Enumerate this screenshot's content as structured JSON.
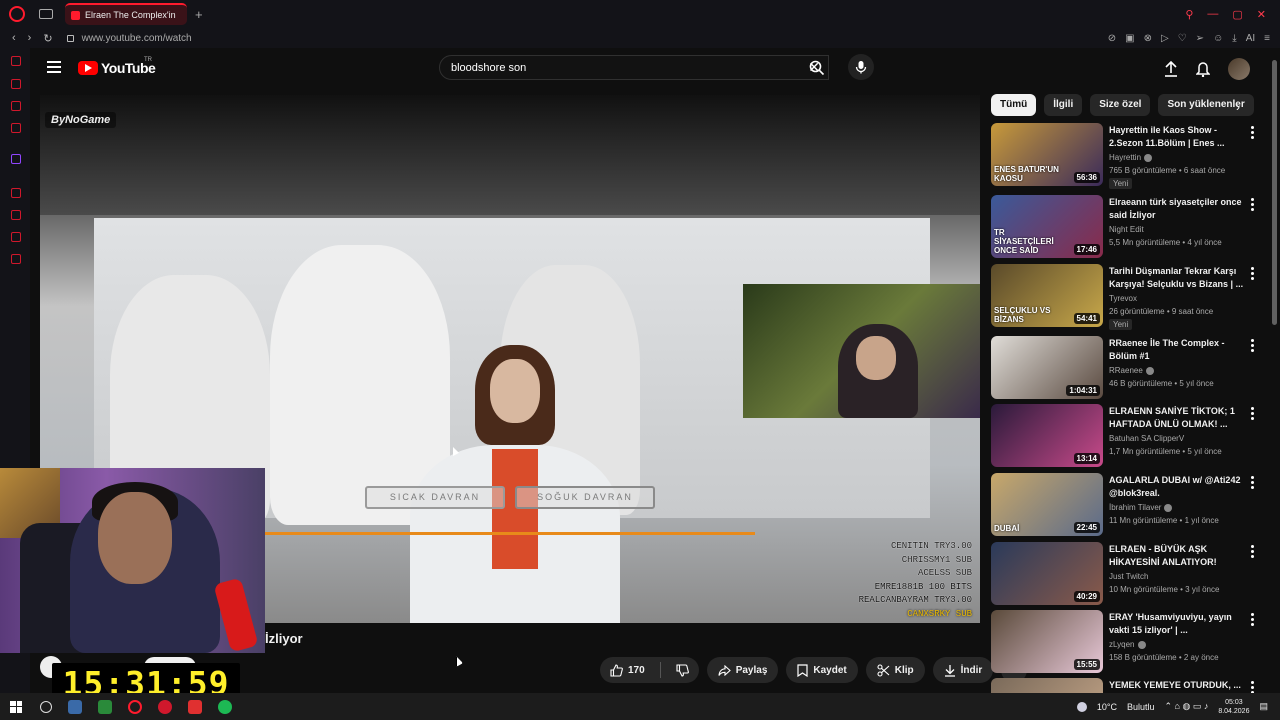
{
  "browser": {
    "tab_title": "Elraen The Complex'in",
    "url": "www.youtube.com/watch",
    "accent_color": "#ff1b2d",
    "ai_label": "AI"
  },
  "youtube": {
    "logo_text": "YouTube",
    "country_code": "TR",
    "search_value": "bloodshore son"
  },
  "video": {
    "watermark": "ByNoGame",
    "choice_hot": "SICAK DAVRAN",
    "choice_cold": "SOĞUK DAVRAN",
    "donations": [
      "CENITIN TRY3.00",
      "CHRISSMY1 SUB",
      "ACELSS SUB",
      "EMRE1881B 100 BITS",
      "REALCANBAYRAM TRY3.00",
      "CANXSRKY SUB"
    ],
    "title_visible": "İzliyor"
  },
  "actions": {
    "likes": "170",
    "share": "Paylaş",
    "save": "Kaydet",
    "clip": "Klip",
    "download": "İndir"
  },
  "overlay": {
    "clock": "15:31:59"
  },
  "chips": [
    "Tümü",
    "İlgili",
    "Size özel",
    "Son yüklenenler"
  ],
  "recommendations": [
    {
      "title": "Hayrettin ile Kaos Show - 2.Sezon 11.Bölüm | Enes ...",
      "channel": "Hayrettin",
      "verified": true,
      "meta": "765 B görüntüleme • 6 saat önce",
      "badge": "Yeni",
      "duration": "56:36",
      "thumb_text": "ENES BATUR'UN KAOSU",
      "colors": [
        "#c89a3a",
        "#3a2a5a"
      ]
    },
    {
      "title": "Elraeann türk siyasetçiler once said İzliyor",
      "channel": "Night Edit",
      "verified": false,
      "meta": "5,5 Mn görüntüleme • 4 yıl önce",
      "badge": "",
      "duration": "17:46",
      "thumb_text": "TR SİYASETÇİLERİ ONCE SAİD",
      "colors": [
        "#3a5a9a",
        "#8a2a4a"
      ]
    },
    {
      "title": "Tarihi Düşmanlar Tekrar Karşı Karşıya! Selçuklu vs Bizans | ...",
      "channel": "Tyrevox",
      "verified": false,
      "meta": "26 görüntüleme • 9 saat önce",
      "badge": "Yeni",
      "duration": "54:41",
      "thumb_text": "SELÇUKLU VS BİZANS",
      "colors": [
        "#5a4a2a",
        "#c8a84a"
      ]
    },
    {
      "title": "RRaenee İle The Complex - Bölüm #1",
      "channel": "RRaenee",
      "verified": true,
      "meta": "46 B görüntüleme • 5 yıl önce",
      "badge": "",
      "duration": "1:04:31",
      "thumb_text": "",
      "colors": [
        "#e0ddd8",
        "#5a4a40"
      ]
    },
    {
      "title": "ELRAENN SANİYE TİKTOK; 1 HAFTADA ÜNLÜ OLMAK! ...",
      "channel": "Batuhan SA ClipperV",
      "verified": false,
      "meta": "1,7 Mn görüntüleme • 5 yıl önce",
      "badge": "",
      "duration": "13:14",
      "thumb_text": "",
      "colors": [
        "#2a1a3a",
        "#c84a8a"
      ]
    },
    {
      "title": "AGALARLA DUBAI w/ @Ati242 @blok3real.",
      "channel": "İbrahim Tilaver",
      "verified": true,
      "meta": "11 Mn görüntüleme • 1 yıl önce",
      "badge": "",
      "duration": "22:45",
      "thumb_text": "DUBAİ",
      "colors": [
        "#c8a86a",
        "#5a6a8a"
      ]
    },
    {
      "title": "ELRAEN - BÜYÜK AŞK HİKAYESİNİ ANLATIYOR!",
      "channel": "Just Twitch",
      "verified": false,
      "meta": "10 Mn görüntüleme • 3 yıl önce",
      "badge": "",
      "duration": "40:29",
      "thumb_text": "",
      "colors": [
        "#2a3a5a",
        "#8a5a4a"
      ]
    },
    {
      "title": "ERAY 'Husamviyuviyu, yayın vakti 15 izliyor' | ...",
      "channel": "zLyqen",
      "verified": true,
      "meta": "158 B görüntüleme • 2 ay önce",
      "badge": "",
      "duration": "15:55",
      "thumb_text": "",
      "colors": [
        "#5a4a3a",
        "#e8c8d8"
      ]
    },
    {
      "title": "YEMEK YEMEYE OTURDUK, ...",
      "channel": "",
      "verified": false,
      "meta": "",
      "badge": "",
      "duration": "",
      "thumb_text": "",
      "colors": [
        "#7a6a5a",
        "#c8a88a"
      ]
    }
  ],
  "taskbar": {
    "weather": "10°C",
    "weather_desc": "Bulutlu",
    "time": "05:03",
    "date": "8.04.2026"
  }
}
